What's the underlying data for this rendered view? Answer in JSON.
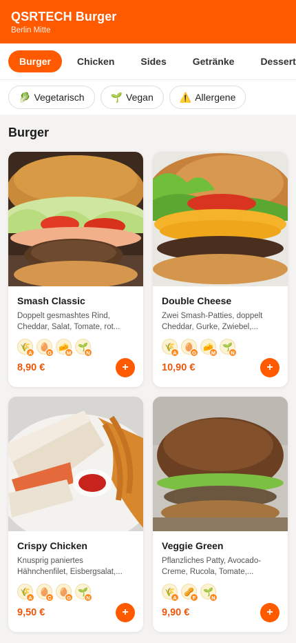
{
  "header": {
    "title": "QSRTECH Burger",
    "subtitle": "Berlin Mitte"
  },
  "tabs": [
    {
      "label": "Burger",
      "active": true
    },
    {
      "label": "Chicken"
    },
    {
      "label": "Sides"
    },
    {
      "label": "Getränke"
    },
    {
      "label": "Desserts"
    }
  ],
  "filters": [
    {
      "icon": "🥬",
      "label": "Vegetarisch"
    },
    {
      "icon": "🌱",
      "label": "Vegan"
    },
    {
      "icon": "⚠️",
      "label": "Allergene"
    }
  ],
  "section": {
    "title": "Burger"
  },
  "products": [
    {
      "name": "Smash Classic",
      "description": "Doppelt gesmashtes Rind, Cheddar, Salat, Tomate, rot...",
      "price": "8,90 €",
      "add_label": "+",
      "allergens": [
        {
          "icon": "🌾",
          "code": "A"
        },
        {
          "icon": "🥚",
          "code": "G"
        },
        {
          "icon": "🧀",
          "code": "M"
        },
        {
          "icon": "🌱",
          "code": "N"
        }
      ]
    },
    {
      "name": "Double Cheese",
      "description": "Zwei Smash-Patties, doppelt Cheddar, Gurke, Zwiebel,...",
      "price": "10,90 €",
      "add_label": "+",
      "allergens": [
        {
          "icon": "🌾",
          "code": "A"
        },
        {
          "icon": "🥚",
          "code": "G"
        },
        {
          "icon": "🧀",
          "code": "M"
        },
        {
          "icon": "🌱",
          "code": "N"
        }
      ]
    },
    {
      "name": "Crispy Chicken",
      "description": "Knusprig paniertes Hähnchenfilet, Eisbergsalat,...",
      "price": "9,50 €",
      "add_label": "+",
      "allergens": [
        {
          "icon": "🌾",
          "code": "A"
        },
        {
          "icon": "🥚",
          "code": "C"
        },
        {
          "icon": "🥚",
          "code": "G"
        },
        {
          "icon": "🌱",
          "code": "N"
        }
      ]
    },
    {
      "name": "Veggie Green",
      "description": "Pflanzliches Patty, Avocado-Creme, Rucola, Tomate,...",
      "price": "9,90 €",
      "add_label": "+",
      "allergens": [
        {
          "icon": "🌾",
          "code": "A"
        },
        {
          "icon": "🥜",
          "code": "F"
        },
        {
          "icon": "🌱",
          "code": "N"
        }
      ]
    }
  ],
  "colors": {
    "brand": "#ff5a00",
    "price": "#e8580c",
    "background": "#f4f3f1"
  }
}
